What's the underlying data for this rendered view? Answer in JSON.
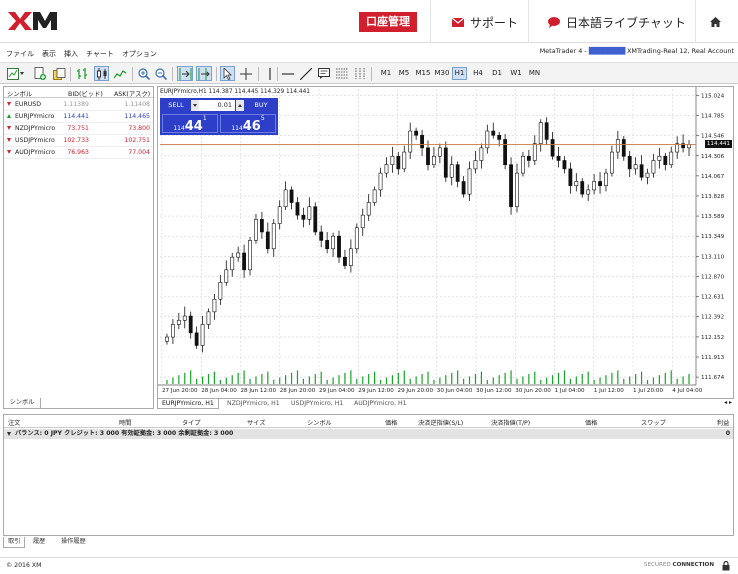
{
  "header": {
    "brand": "XM",
    "account_button": "口座管理",
    "support": "サポート",
    "live_chat": "日本語ライブチャット"
  },
  "menu": {
    "items": [
      "ファイル",
      "表示",
      "挿入",
      "チャート",
      "オプション"
    ],
    "account_info_prefix": "MetaTrader 4 - ",
    "account_info_hidden": "████████",
    "account_info_suffix": "XMTrading-Real 12, Real Account"
  },
  "toolbar": {
    "timeframes": [
      "M1",
      "M5",
      "M15",
      "M30",
      "H1",
      "H4",
      "D1",
      "W1",
      "MN"
    ],
    "active_timeframe": "H1"
  },
  "market_watch": {
    "headers": {
      "symbol": "シンボル",
      "bid": "BID(ビッド)",
      "ask": "ASK(アスク)"
    },
    "rows": [
      {
        "symbol": "EURUSD",
        "bid": "1.11389",
        "ask": "1.11408",
        "direction": "down",
        "color": "#999999"
      },
      {
        "symbol": "EURJPYmicro",
        "bid": "114.441",
        "ask": "114.465",
        "direction": "up",
        "color": "#2a3fbf"
      },
      {
        "symbol": "NZDJPYmicro",
        "bid": "73.751",
        "ask": "73.800",
        "direction": "down",
        "color": "#d11f2d"
      },
      {
        "symbol": "USDJPYmicro",
        "bid": "102.733",
        "ask": "102.751",
        "direction": "down",
        "color": "#d11f2d"
      },
      {
        "symbol": "AUDJPYmicro",
        "bid": "76.963",
        "ask": "77.004",
        "direction": "down",
        "color": "#d11f2d"
      }
    ],
    "tab": "シンボル"
  },
  "chart": {
    "header": "EURJPYmicro,H1  114.387 114.445 114.329 114.441",
    "trade_panel": {
      "sell": "SELL",
      "buy": "BUY",
      "lot": "0.01",
      "sell_small": "114",
      "sell_big": "44",
      "sell_pip": "1",
      "buy_small": "114",
      "buy_big": "46",
      "buy_pip": "5"
    },
    "current_price_label": "114.441",
    "tabs": [
      "EURJPYmicro, H1",
      "NZDJPYmicro, H1",
      "USDJPYmicro, H1",
      "AUDJPYmicro, H1"
    ],
    "active_tab": 0
  },
  "chart_data": {
    "type": "candlestick",
    "title": "EURJPYmicro,H1",
    "symbol": "EURJPYmicro",
    "timeframe": "H1",
    "ohlc_header": {
      "open": 114.387,
      "high": 114.445,
      "low": 114.329,
      "close": 114.441
    },
    "y_ticks": [
      "115.024",
      "114.785",
      "114.546",
      "114.306",
      "114.067",
      "113.828",
      "113.589",
      "113.349",
      "113.110",
      "112.870",
      "112.631",
      "112.392",
      "112.152",
      "111.913",
      "111.674"
    ],
    "ylim": [
      111.58,
      115.1
    ],
    "x_ticks": [
      "27 Jun 20:00",
      "28 Jun 04:00",
      "28 Jun 12:00",
      "28 Jun 20:00",
      "29 Jun 04:00",
      "29 Jun 12:00",
      "29 Jun 20:00",
      "30 Jun 04:00",
      "30 Jun 12:00",
      "30 Jun 20:00",
      "1 Jul 04:00",
      "1 Jul 12:00",
      "1 Jul 20:00",
      "4 Jul 04:00"
    ],
    "current_price": 114.441,
    "closes": [
      112.15,
      112.3,
      112.35,
      112.4,
      112.2,
      112.05,
      112.3,
      112.45,
      112.6,
      112.8,
      112.95,
      113.1,
      113.15,
      112.95,
      113.3,
      113.55,
      113.4,
      113.2,
      113.5,
      113.7,
      113.9,
      113.75,
      113.6,
      113.55,
      113.7,
      113.4,
      113.3,
      113.2,
      113.35,
      113.1,
      113.0,
      113.2,
      113.45,
      113.6,
      113.75,
      113.9,
      114.1,
      114.2,
      114.3,
      114.15,
      114.35,
      114.6,
      114.55,
      114.4,
      114.2,
      114.3,
      114.4,
      114.05,
      114.2,
      114.0,
      113.85,
      114.15,
      114.25,
      114.4,
      114.6,
      114.55,
      114.5,
      114.2,
      113.7,
      114.1,
      114.3,
      114.25,
      114.45,
      114.7,
      114.5,
      114.3,
      114.25,
      114.15,
      113.95,
      114.0,
      113.85,
      113.9,
      114.0,
      113.95,
      114.1,
      114.35,
      114.5,
      114.3,
      114.15,
      114.2,
      114.05,
      114.1,
      114.25,
      114.3,
      114.2,
      114.35,
      114.45,
      114.4,
      114.44
    ]
  },
  "terminal": {
    "headers": [
      "注文",
      "時間",
      "タイプ",
      "サイズ",
      "シンボル",
      "価格",
      "決済逆指値(S/L)",
      "決済指値(T/P)",
      "価格",
      "スワップ",
      "利益"
    ],
    "balance": "バランス: 0 JPY  クレジット: 3 000  有効証拠金: 3 000  余剰証拠金: 3 000",
    "profit": "0",
    "tabs": [
      "取引",
      "履歴",
      "操作履歴"
    ],
    "active_tab": 0
  },
  "footer": {
    "copyright": "© 2016 XM",
    "secured": "SECURED",
    "connection": "CONNECTION"
  },
  "colors": {
    "brand_red": "#d11f2d",
    "trade_panel_blue": "#2d3fc9",
    "grid": "#d4d4d4",
    "volume_green": "#1aa32a"
  }
}
